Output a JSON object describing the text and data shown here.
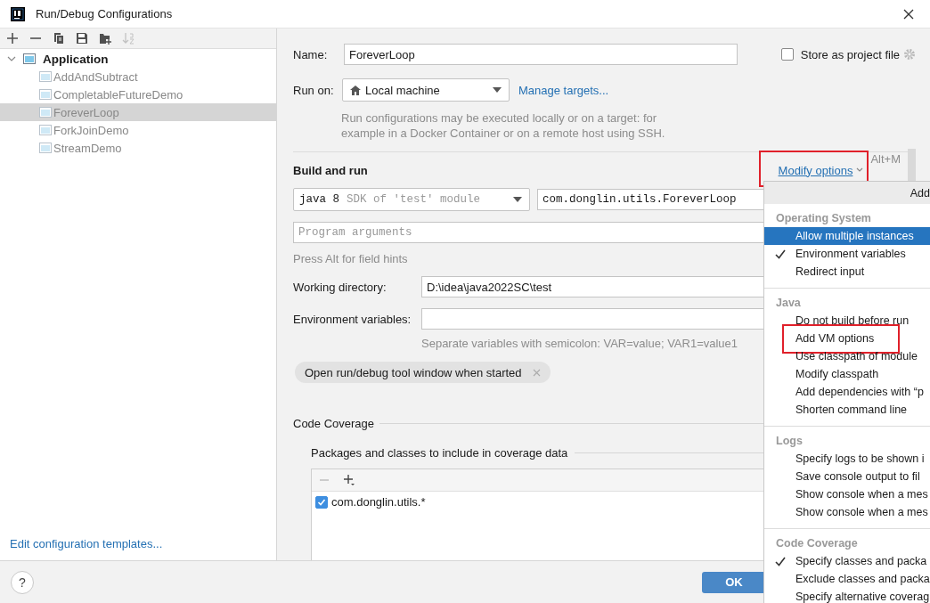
{
  "window": {
    "title": "Run/Debug Configurations"
  },
  "toolbar": [
    {
      "kind": "add",
      "disabled": false
    },
    {
      "kind": "remove",
      "disabled": false
    },
    {
      "kind": "copy",
      "disabled": false
    },
    {
      "kind": "save",
      "disabled": false
    },
    {
      "kind": "new-folder",
      "disabled": false
    },
    {
      "kind": "sort",
      "disabled": true
    }
  ],
  "tree": {
    "label": "Application",
    "expanded": true,
    "children": [
      {
        "label": "AddAndSubtract",
        "selected": false
      },
      {
        "label": "CompletableFutureDemo",
        "selected": false
      },
      {
        "label": "ForeverLoop",
        "selected": true
      },
      {
        "label": "ForkJoinDemo",
        "selected": false
      },
      {
        "label": "StreamDemo",
        "selected": false
      }
    ]
  },
  "templates_link": "Edit configuration templates...",
  "name": {
    "label": "Name:",
    "value": "ForeverLoop"
  },
  "store_as_project_file": {
    "label": "Store as project file",
    "checked": false
  },
  "run_on": {
    "label": "Run on:",
    "value": "Local machine",
    "link": "Manage targets..."
  },
  "run_on_hint": [
    "Run configurations may be executed locally or on a target: for",
    "example in a Docker Container or on a remote host using SSH."
  ],
  "build_and_run": {
    "title": "Build and run",
    "modify_options": {
      "label": "Modify options",
      "highlighted": true
    },
    "shortcut": "Alt+M",
    "sdk": {
      "value": "java 8",
      "hint": "SDK of 'test' module"
    },
    "main_class": "com.donglin.utils.ForeverLoop",
    "program_arguments": {
      "placeholder": "Program arguments"
    },
    "hint": "Press Alt for field hints"
  },
  "working_directory": {
    "label": "Working directory:",
    "value": "D:\\idea\\java2022SC\\test"
  },
  "environment_variables": {
    "label": "Environment variables:",
    "hint": "Separate variables with semicolon: VAR=value; VAR1=value1"
  },
  "chips": [
    {
      "label": "Open run/debug tool window when started"
    }
  ],
  "code_coverage": {
    "title": "Code Coverage",
    "subtitle": "Packages and classes to include in coverage data",
    "entries": [
      {
        "label": "com.donglin.utils.*",
        "checked": true
      }
    ]
  },
  "help_button": "?",
  "buttons": [
    {
      "label": "OK",
      "default": true
    }
  ],
  "popup": {
    "header": "Add",
    "sections": [
      {
        "title": "Operating System",
        "items": [
          {
            "label": "Allow multiple instances",
            "selected": true,
            "checked": false,
            "highlighted": false
          },
          {
            "label": "Environment variables",
            "selected": false,
            "checked": true,
            "highlighted": false
          },
          {
            "label": "Redirect input",
            "selected": false,
            "checked": false,
            "highlighted": false
          }
        ]
      },
      {
        "title": "Java",
        "items": [
          {
            "label": "Do not build before run",
            "selected": false,
            "checked": false,
            "highlighted": false
          },
          {
            "label": "Add VM options",
            "selected": false,
            "checked": false,
            "highlighted": true
          },
          {
            "label": "Use classpath of module",
            "selected": false,
            "checked": false,
            "highlighted": false
          },
          {
            "label": "Modify classpath",
            "selected": false,
            "checked": false,
            "highlighted": false
          },
          {
            "label": "Add dependencies with “p",
            "selected": false,
            "checked": false,
            "highlighted": false
          },
          {
            "label": "Shorten command line",
            "selected": false,
            "checked": false,
            "highlighted": false
          }
        ]
      },
      {
        "title": "Logs",
        "items": [
          {
            "label": "Specify logs to be shown i",
            "selected": false,
            "checked": false,
            "highlighted": false
          },
          {
            "label": "Save console output to fil",
            "selected": false,
            "checked": false,
            "highlighted": false
          },
          {
            "label": "Show console when a mes",
            "selected": false,
            "checked": false,
            "highlighted": false
          },
          {
            "label": "Show console when a mes",
            "selected": false,
            "checked": false,
            "highlighted": false
          }
        ]
      },
      {
        "title": "Code Coverage",
        "items": [
          {
            "label": "Specify classes and packa",
            "selected": false,
            "checked": true,
            "highlighted": false
          },
          {
            "label": "Exclude classes and packa",
            "selected": false,
            "checked": false,
            "highlighted": false
          },
          {
            "label": "Specify alternative coverag",
            "selected": false,
            "checked": false,
            "highlighted": false
          }
        ]
      }
    ]
  }
}
